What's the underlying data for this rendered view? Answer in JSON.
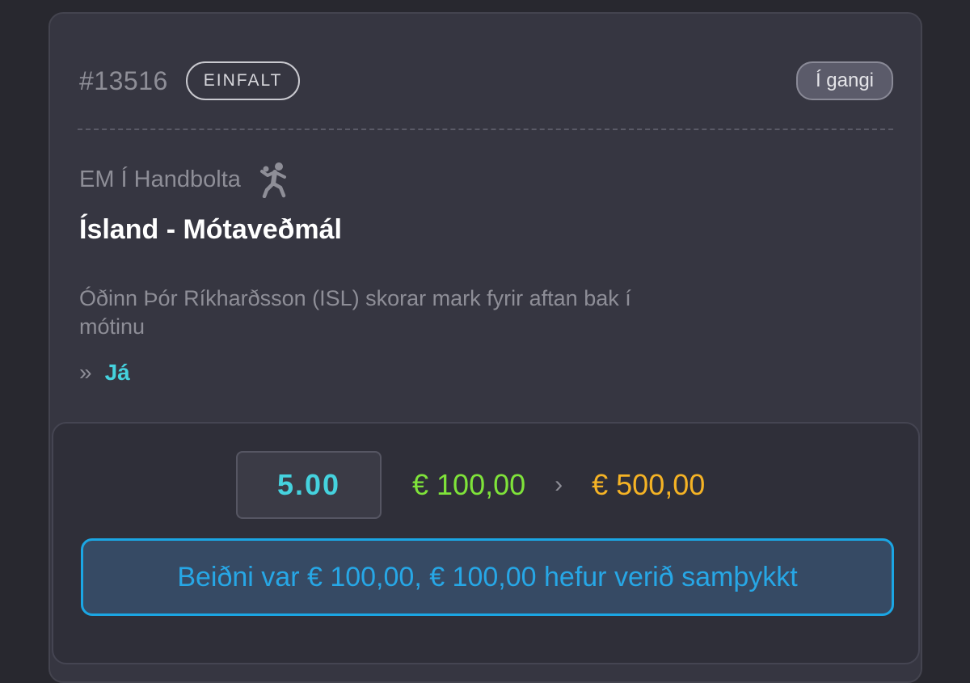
{
  "bet": {
    "id": "#13516",
    "type": "EINFALT",
    "status": "Í gangi",
    "competition": "EM Í Handbolta",
    "sport_icon": "handball-player-icon",
    "market": "Ísland - Mótaveðmál",
    "selection_description": "Óðinn Þór Ríkharðsson (ISL) skorar mark fyrir aftan bak í mótinu",
    "pick_marker": "»",
    "pick": "Já"
  },
  "summary": {
    "odds": "5.00",
    "stake": "€ 100,00",
    "separator": "›",
    "payout": "€ 500,00",
    "message": "Beiðni var € 100,00, € 100,00 hefur verið samþykkt"
  },
  "colors": {
    "background": "#28282f",
    "card": "#363641",
    "accent_cyan": "#45d2de",
    "stake_green": "#7fe33a",
    "payout_orange": "#f5b325",
    "info_blue": "#1ba6e4"
  }
}
